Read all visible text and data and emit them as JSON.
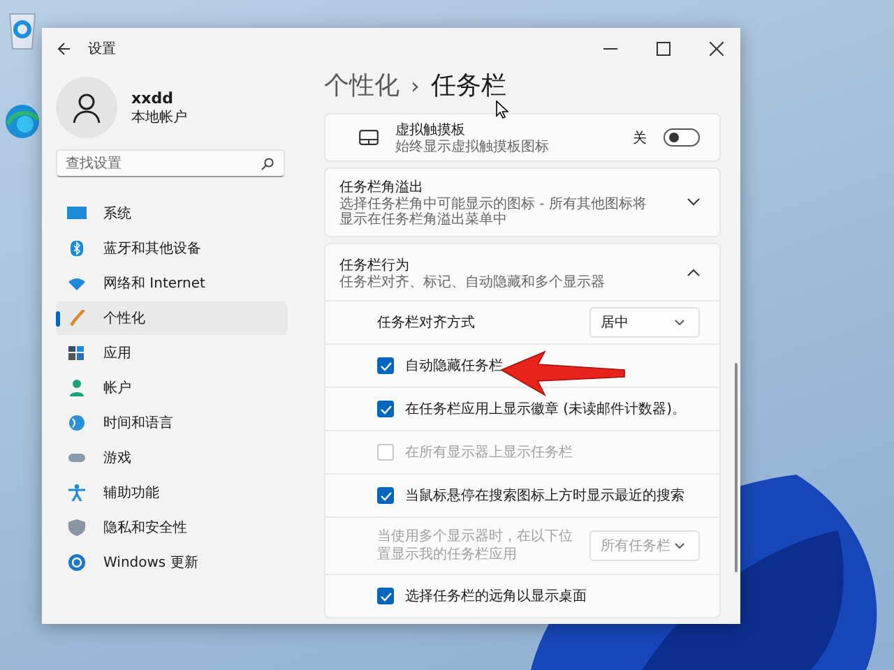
{
  "desktop": {
    "icons": [
      {
        "kind": "recycle-bin"
      },
      {
        "kind": "edge"
      }
    ]
  },
  "window": {
    "title": "设置"
  },
  "account": {
    "name": "xxdd",
    "type": "本地帐户"
  },
  "search": {
    "placeholder": "查找设置"
  },
  "nav": [
    {
      "label": "系统",
      "selected": false
    },
    {
      "label": "蓝牙和其他设备",
      "selected": false
    },
    {
      "label": "网络和 Internet",
      "selected": false
    },
    {
      "label": "个性化",
      "selected": true
    },
    {
      "label": "应用",
      "selected": false
    },
    {
      "label": "帐户",
      "selected": false
    },
    {
      "label": "时间和语言",
      "selected": false
    },
    {
      "label": "游戏",
      "selected": false
    },
    {
      "label": "辅助功能",
      "selected": false
    },
    {
      "label": "隐私和安全性",
      "selected": false
    },
    {
      "label": "Windows 更新",
      "selected": false
    }
  ],
  "breadcrumb": {
    "parent": "个性化",
    "separator": "›",
    "current": "任务栏"
  },
  "touchpad": {
    "title": "虚拟触摸板",
    "description": "始终显示虚拟触摸板图标",
    "toggle_label": "关",
    "on": false
  },
  "sections": [
    {
      "title": "任务栏角溢出",
      "description": "选择任务栏角中可能显示的图标 - 所有其他图标将显示在任务栏角溢出菜单中",
      "expanded": false
    },
    {
      "title": "任务栏行为",
      "description": "任务栏对齐、标记、自动隐藏和多个显示器",
      "expanded": true,
      "settings": [
        {
          "kind": "dropdown",
          "label": "任务栏对齐方式",
          "value": "居中",
          "disabled": false
        },
        {
          "kind": "checkbox",
          "label": "自动隐藏任务栏",
          "checked": true,
          "disabled": false
        },
        {
          "kind": "checkbox",
          "label": "在任务栏应用上显示徽章 (未读邮件计数器)。",
          "checked": true,
          "disabled": false
        },
        {
          "kind": "checkbox",
          "label": "在所有显示器上显示任务栏",
          "checked": false,
          "disabled": true
        },
        {
          "kind": "checkbox",
          "label": "当鼠标悬停在搜索图标上方时显示最近的搜索",
          "checked": true,
          "disabled": false
        },
        {
          "kind": "dropdown",
          "label": "当使用多个显示器时，在以下位置显示我的任务栏应用",
          "value": "所有任务栏",
          "disabled": true
        },
        {
          "kind": "checkbox",
          "label": "选择任务栏的远角以显示桌面",
          "checked": true,
          "disabled": false
        }
      ]
    }
  ]
}
